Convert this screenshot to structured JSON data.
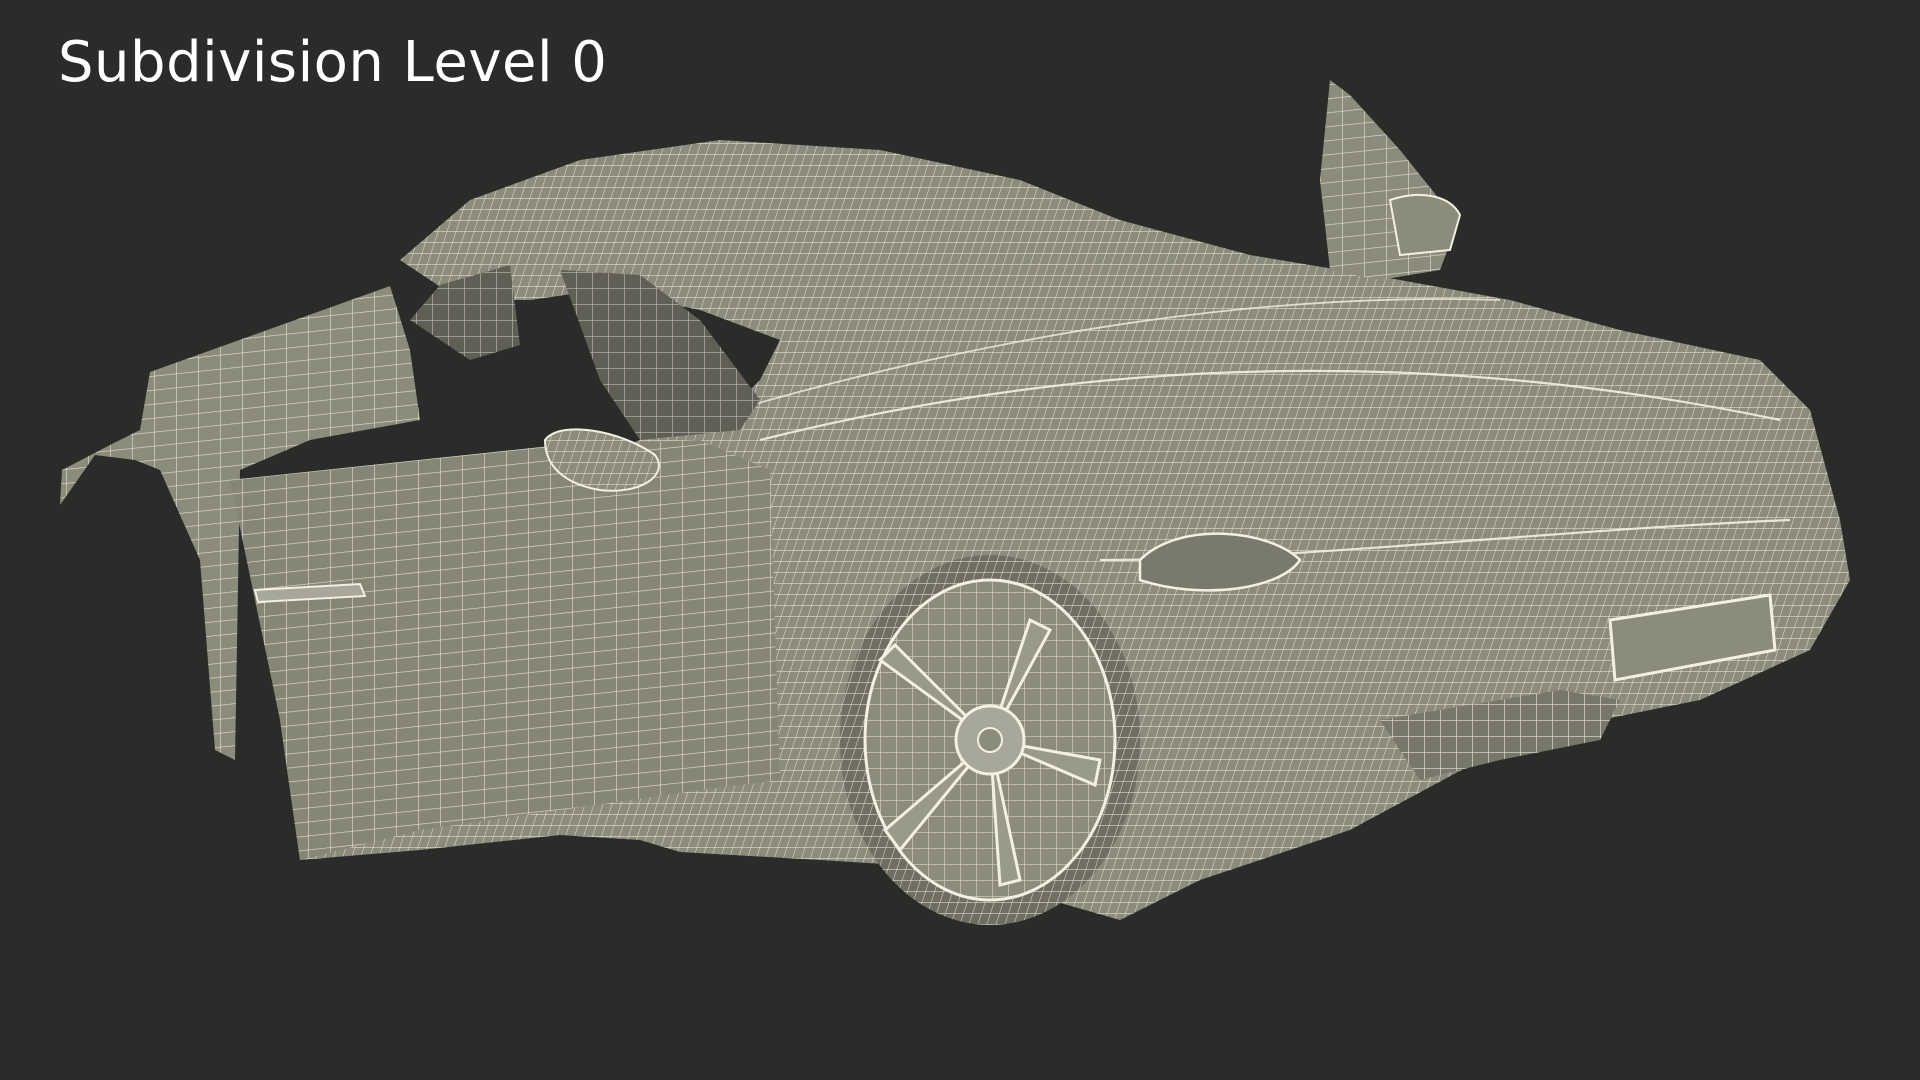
{
  "title": "Subdivision Level 0",
  "colors": {
    "background": "#2b2b2a",
    "mesh_fill": "#8c8c7d",
    "mesh_fill_shadow": "#6e6e62",
    "wire": "#f2f0e0",
    "title_text": "#ffffff"
  }
}
